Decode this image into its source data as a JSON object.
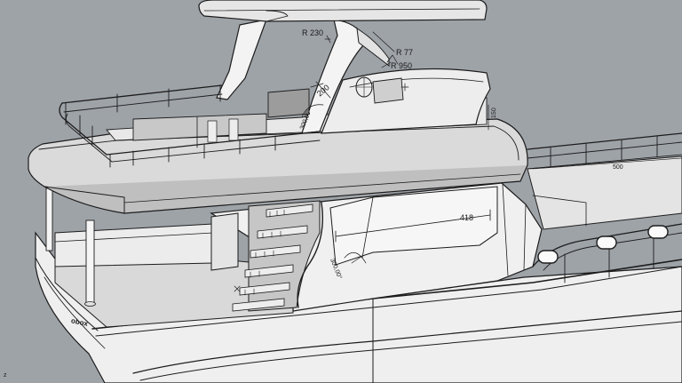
{
  "viewport": {
    "background": "#9ea3a8",
    "hull_fill": "#f2f2f2",
    "deck_fill": "#d6d6d6",
    "shadow_fill": "#bdbdbd",
    "line_color": "#1c1c1c"
  },
  "annotations": {
    "radius_230": "R 230",
    "radius_77": "R 77",
    "radius_950": "R 950",
    "dim_200": "200",
    "dim_150": "150",
    "dim_500": "500",
    "dim_418": "418",
    "angle_upper": "300,00°",
    "angle_lower": "300,00°",
    "axis_label": "z",
    "hull_logo": "obox"
  }
}
